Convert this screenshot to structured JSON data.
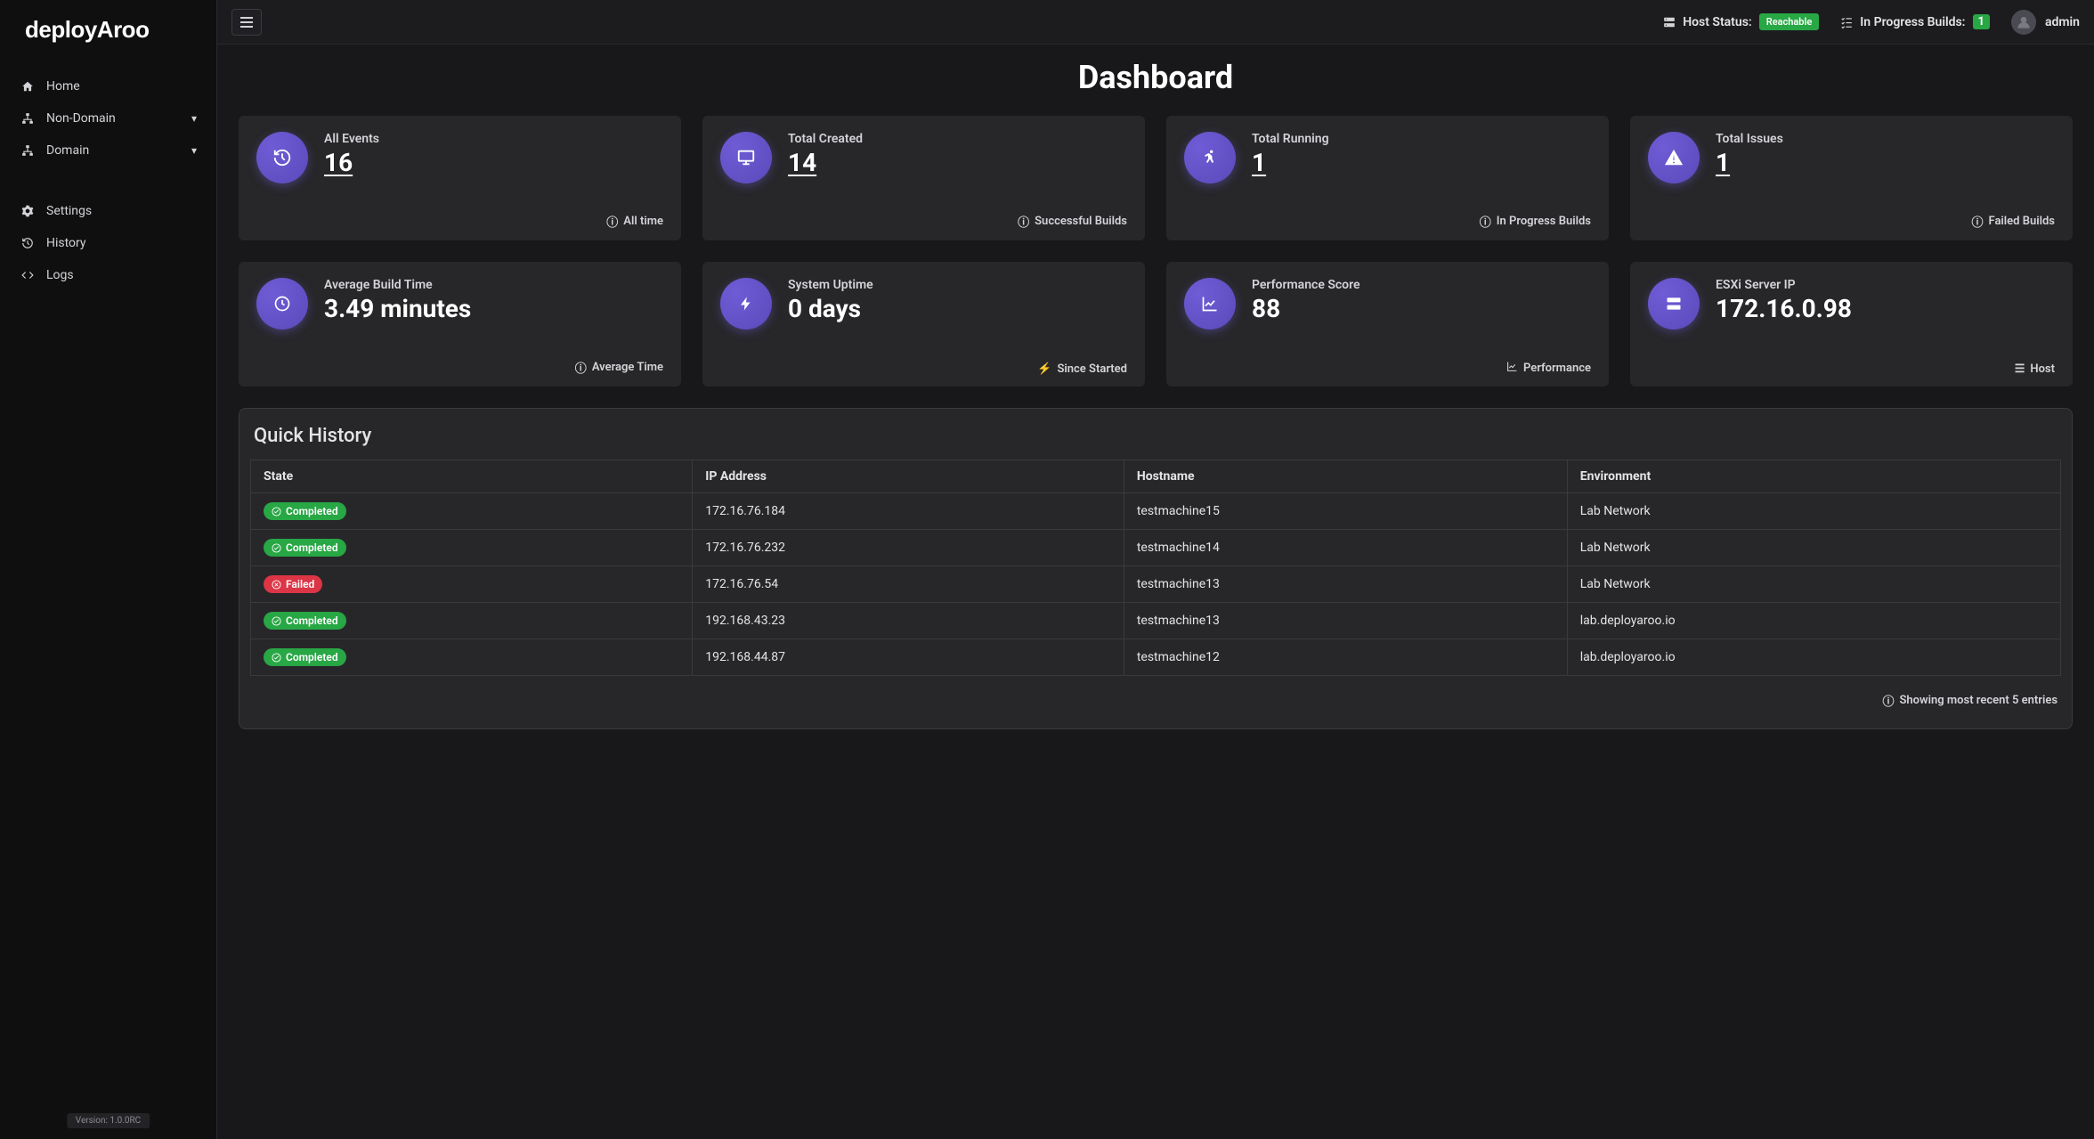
{
  "brand": "deployAroo",
  "sidebar": {
    "items": [
      {
        "label": "Home"
      },
      {
        "label": "Non-Domain"
      },
      {
        "label": "Domain"
      }
    ],
    "lower": [
      {
        "label": "Settings"
      },
      {
        "label": "History"
      },
      {
        "label": "Logs"
      }
    ],
    "version_label": "Version:",
    "version_value": "1.0.0RC"
  },
  "topbar": {
    "host_status_label": "Host Status:",
    "host_status_value": "Reachable",
    "progress_label": "In Progress Builds:",
    "progress_value": "1",
    "username": "admin"
  },
  "page_title": "Dashboard",
  "cards": [
    {
      "label": "All Events",
      "value": "16",
      "footer": "All time",
      "link": true
    },
    {
      "label": "Total Created",
      "value": "14",
      "footer": "Successful Builds",
      "link": true
    },
    {
      "label": "Total Running",
      "value": "1",
      "footer": "In Progress Builds",
      "link": true
    },
    {
      "label": "Total Issues",
      "value": "1",
      "footer": "Failed Builds",
      "link": true
    },
    {
      "label": "Average Build Time",
      "value": "3.49 minutes",
      "footer": "Average Time",
      "link": false
    },
    {
      "label": "System Uptime",
      "value": "0 days",
      "footer": "Since Started",
      "link": false
    },
    {
      "label": "Performance Score",
      "value": "88",
      "footer": "Performance",
      "link": false
    },
    {
      "label": "ESXi Server IP",
      "value": "172.16.0.98",
      "footer": "Host",
      "link": false
    }
  ],
  "history": {
    "title": "Quick History",
    "columns": [
      "State",
      "IP Address",
      "Hostname",
      "Environment"
    ],
    "rows": [
      {
        "state": "Completed",
        "ok": true,
        "ip": "172.16.76.184",
        "host": "testmachine15",
        "env": "Lab Network"
      },
      {
        "state": "Completed",
        "ok": true,
        "ip": "172.16.76.232",
        "host": "testmachine14",
        "env": "Lab Network"
      },
      {
        "state": "Failed",
        "ok": false,
        "ip": "172.16.76.54",
        "host": "testmachine13",
        "env": "Lab Network"
      },
      {
        "state": "Completed",
        "ok": true,
        "ip": "192.168.43.23",
        "host": "testmachine13",
        "env": "lab.deployaroo.io"
      },
      {
        "state": "Completed",
        "ok": true,
        "ip": "192.168.44.87",
        "host": "testmachine12",
        "env": "lab.deployaroo.io"
      }
    ],
    "footer": "Showing most recent 5 entries"
  }
}
